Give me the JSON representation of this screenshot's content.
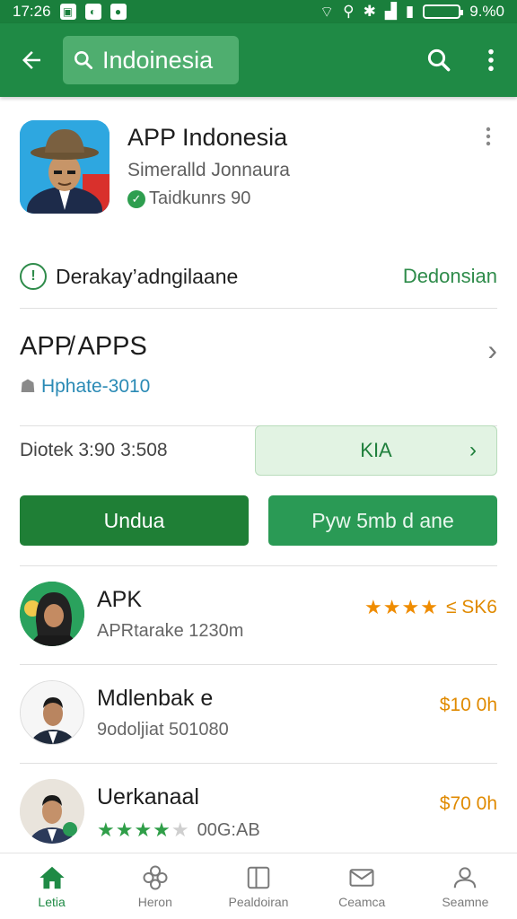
{
  "status_bar": {
    "time": "17:26",
    "battery": "9.%0"
  },
  "app_bar": {
    "search_text": "Indoinesia"
  },
  "app": {
    "title": "APP Indonesia",
    "developer": "Simeralld Jonnaura",
    "verified_text": "Taidkunrs 90"
  },
  "info": {
    "text": "Derakay’adngilaane",
    "link": "Dedonsian"
  },
  "apps_section": {
    "title": "APP̸ APPS",
    "subtitle": "Hphate-3010"
  },
  "date_row": {
    "text": "Diotek 3:90 3:508",
    "kia_label": "KIA"
  },
  "buttons": {
    "primary": "Undua",
    "secondary": "Pyw 5mb d  ane"
  },
  "list": [
    {
      "title": "APK",
      "subtitle": "APRtarake 1230m",
      "right": "≤ SK6",
      "stars": 4
    },
    {
      "title": "Mdlenbak e",
      "subtitle": "9odoljiat 501080",
      "right": "$10 0h"
    },
    {
      "title": "Uerkanaal",
      "subtitle": "00G:AB",
      "right": "$70 0h",
      "stars": 4
    }
  ],
  "nav": [
    {
      "label": "Letia",
      "icon": "home-icon"
    },
    {
      "label": "Heron",
      "icon": "flower-icon"
    },
    {
      "label": "Pealdoiran",
      "icon": "book-icon"
    },
    {
      "label": "Ceamca",
      "icon": "mail-icon"
    },
    {
      "label": "Seamne",
      "icon": "person-icon"
    }
  ],
  "colors": {
    "app_bar": "#1f8a45",
    "status_bar": "#1a7f3c",
    "primary_button": "#1f7f36",
    "accent_green": "#2e8b4a",
    "price_orange": "#e08a00"
  }
}
